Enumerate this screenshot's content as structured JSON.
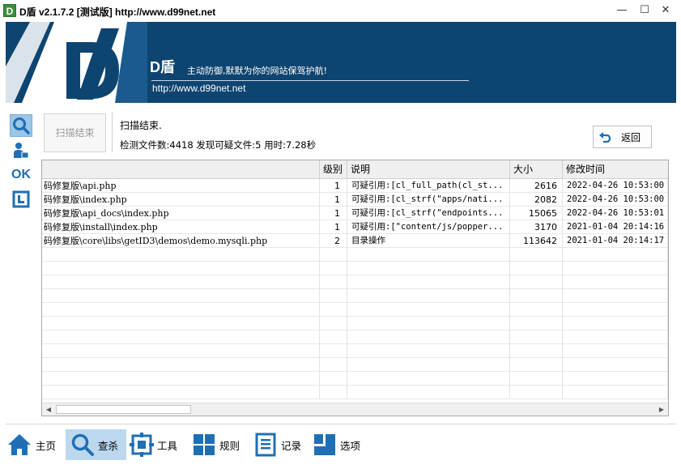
{
  "window": {
    "title": "D盾 v2.1.7.2 [测试版] http://www.d99net.net",
    "icon_letter": "D",
    "controls": [
      "minimize-icon",
      "maximize-icon",
      "close-icon"
    ]
  },
  "banner": {
    "logo_letter": "D",
    "brand": "D盾",
    "slogan": "主动防御,默默为你的网站保驾护航!",
    "url": "http://www.d99net.net"
  },
  "left_rail": [
    {
      "name": "search-icon",
      "active": true
    },
    {
      "name": "user-scan-icon",
      "active": false
    },
    {
      "name": "ok-icon",
      "text": "OK",
      "active": false
    },
    {
      "name": "frame-icon",
      "active": false
    }
  ],
  "panel": {
    "scan_button": "扫描结束",
    "status": "扫描结束.",
    "stats": "检测文件数:4418 发现可疑文件:5 用时:7.28秒",
    "back_button": "返回"
  },
  "table": {
    "columns": [
      "",
      "级别",
      "说明",
      "大小",
      "修改时间"
    ],
    "rows": [
      {
        "path": "码修复版\\api.php",
        "level": "1",
        "desc": "可疑引用:[cl_full_path(cl_st...",
        "size": "2616",
        "mtime": "2022-04-26 10:53:00"
      },
      {
        "path": "码修复版\\index.php",
        "level": "1",
        "desc": "可疑引用:[cl_strf(\"apps/nati...",
        "size": "2082",
        "mtime": "2022-04-26 10:53:00"
      },
      {
        "path": "码修复版\\api_docs\\index.php",
        "level": "1",
        "desc": "可疑引用:[cl_strf(\"endpoints...",
        "size": "15065",
        "mtime": "2022-04-26 10:53:01"
      },
      {
        "path": "码修复版\\install\\index.php",
        "level": "1",
        "desc": "可疑引用:[\"content/js/popper...",
        "size": "3170",
        "mtime": "2021-01-04 20:14:16"
      },
      {
        "path": "码修复版\\core\\libs\\getID3\\demos\\demo.mysqli.php",
        "level": "2",
        "desc": "目录操作",
        "size": "113642",
        "mtime": "2021-01-04 20:14:17"
      }
    ],
    "empty_rows": 11,
    "scroll_left": "◀",
    "scroll_right": "▶"
  },
  "bottom_nav": [
    {
      "label": "主页",
      "icon": "home-icon",
      "active": false
    },
    {
      "label": "查杀",
      "icon": "search-icon",
      "active": true
    },
    {
      "label": "工具",
      "icon": "tools-icon",
      "active": false
    },
    {
      "label": "规则",
      "icon": "rules-icon",
      "active": false
    },
    {
      "label": "记录",
      "icon": "log-icon",
      "active": false
    },
    {
      "label": "选项",
      "icon": "options-icon",
      "active": false
    }
  ],
  "colors": {
    "banner_bg": "#0e4470",
    "accent": "#1f6fb5",
    "active_bg": "#bcd8ee"
  }
}
